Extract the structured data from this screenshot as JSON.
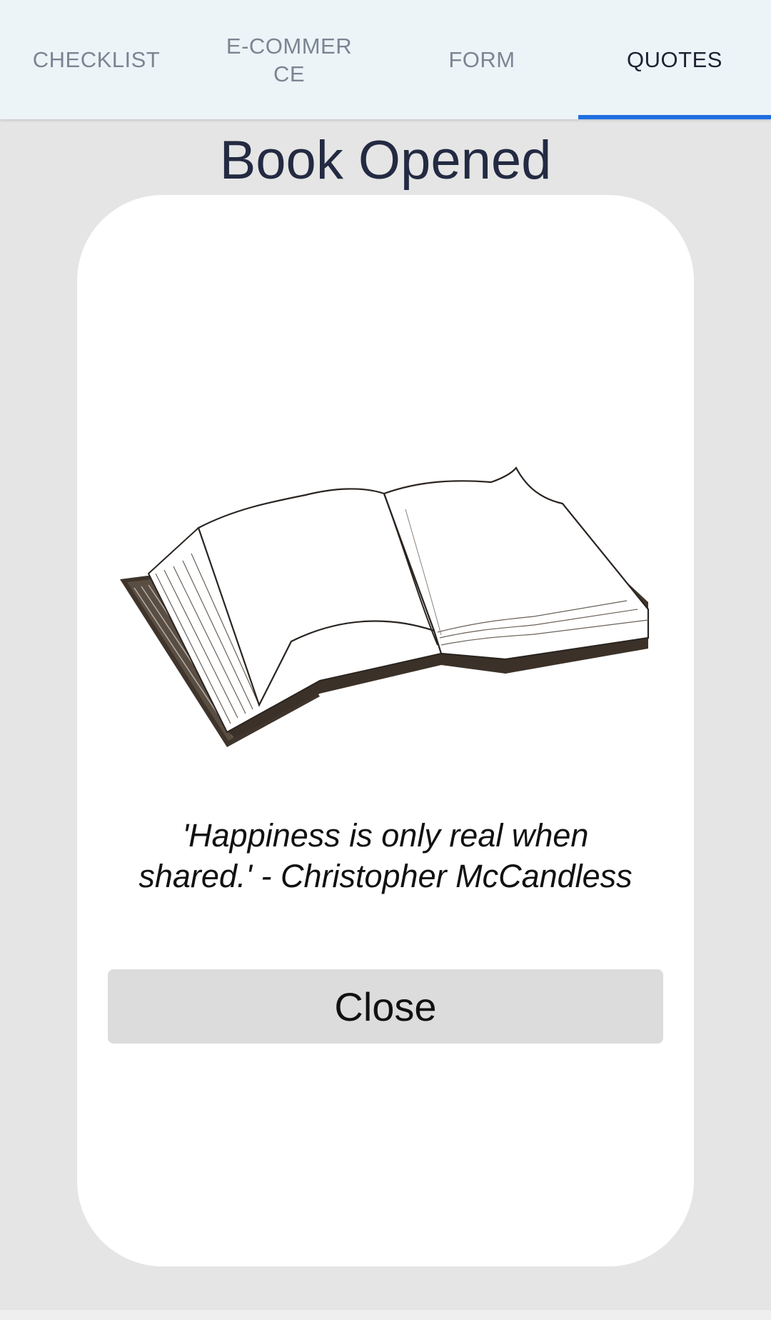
{
  "tabs": [
    {
      "label": "CHECKLIST",
      "active": false
    },
    {
      "label": "E-COMMERCE",
      "active": false
    },
    {
      "label": "FORM",
      "active": false
    },
    {
      "label": "QUOTES",
      "active": true
    }
  ],
  "page_title": "Book Opened",
  "card": {
    "image": "open-book-illustration",
    "quote": "'Happiness is only real when shared.' - Christopher McCandless",
    "close_label": "Close"
  },
  "colors": {
    "tab_bar_bg": "#edf4f8",
    "active_indicator": "#1f6fe0",
    "title_color": "#232a42",
    "background": "#e5e5e5",
    "button_bg": "#dcdcdc"
  }
}
